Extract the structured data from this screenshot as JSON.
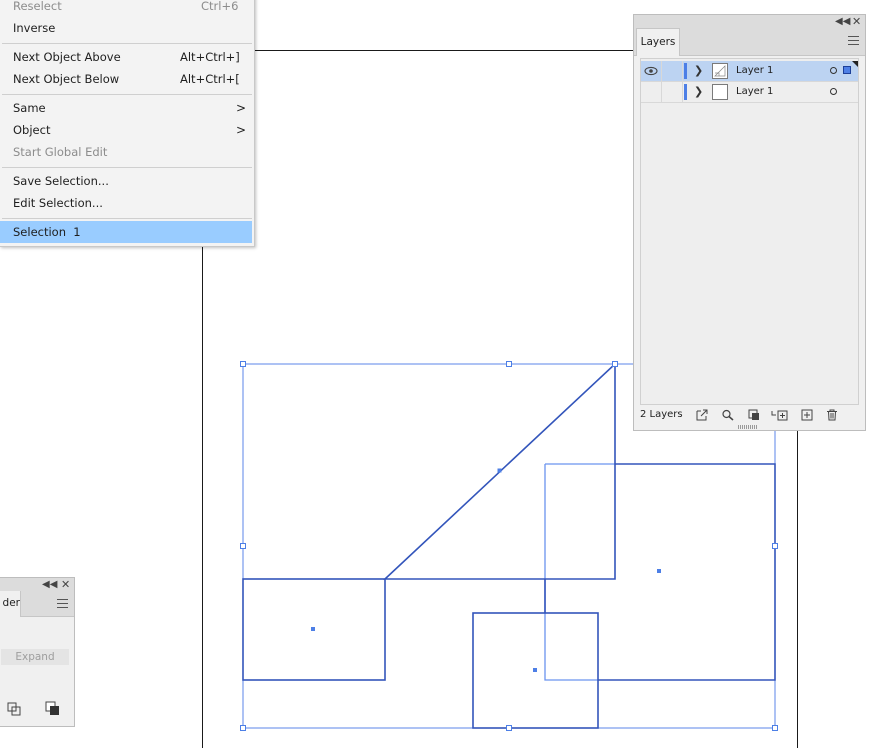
{
  "menu": {
    "items": [
      {
        "label": "Reselect",
        "shortcut": "Ctrl+6",
        "disabled": true
      },
      {
        "label": "Inverse"
      },
      {
        "label": "Next Object Above",
        "shortcut": "Alt+Ctrl+]"
      },
      {
        "label": "Next Object Below",
        "shortcut": "Alt+Ctrl+["
      },
      {
        "label": "Same",
        "submenu": ">"
      },
      {
        "label": "Object",
        "submenu": ">"
      },
      {
        "label": "Start Global Edit",
        "disabled": true
      },
      {
        "label": "Save Selection..."
      },
      {
        "label": "Edit Selection..."
      },
      {
        "label": "Selection  1",
        "highlighted": true
      }
    ]
  },
  "layers_panel": {
    "collapse_icon": "double-chevron-left-icon",
    "close_icon": "close-icon",
    "tab_label": "Layers",
    "rows": [
      {
        "name": "Layer 1",
        "selected": true,
        "visible": true
      },
      {
        "name": "Layer 1",
        "selected": false,
        "visible": false
      }
    ],
    "footer_count": "2 Layers",
    "accent_color": "#4d7fe6",
    "selected_row_color": "#bcd3f2"
  },
  "pathfinder_panel": {
    "tab_label": "der",
    "expand_label": "Expand"
  },
  "canvas": {
    "selection_color": "#3355bb",
    "accent_color": "#4d7fe6"
  }
}
